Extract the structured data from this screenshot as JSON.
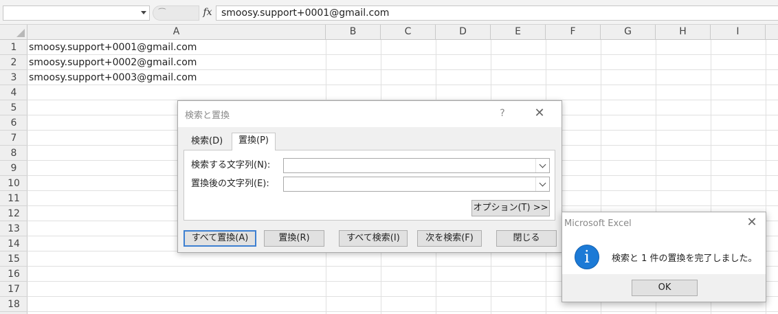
{
  "formula_bar": {
    "name_box_value": "",
    "fx_label": "fx",
    "dots": "⁀",
    "formula_value": "smoosy.support+0001@gmail.com"
  },
  "sheet": {
    "columns": [
      "A",
      "B",
      "C",
      "D",
      "E",
      "F",
      "G",
      "H",
      "I"
    ],
    "rows": [
      "1",
      "2",
      "3",
      "4",
      "5",
      "6",
      "7",
      "8",
      "9",
      "10",
      "11",
      "12",
      "13",
      "14",
      "15",
      "16",
      "17",
      "18"
    ],
    "cells": {
      "A1": "smoosy.support+0001@gmail.com",
      "A2": "smoosy.support+0002@gmail.com",
      "A3": "smoosy.support+0003@gmail.com"
    }
  },
  "find_replace_dialog": {
    "title": "検索と置換",
    "help_label": "?",
    "close_label": "✕",
    "tabs": [
      {
        "label": "検索(D)",
        "active": false
      },
      {
        "label": "置換(P)",
        "active": true
      }
    ],
    "find_label": "検索する文字列(N):",
    "find_value": "",
    "replace_label": "置換後の文字列(E):",
    "replace_value": "",
    "options_button": "オプション(T) >>",
    "buttons": {
      "replace_all": "すべて置換(A)",
      "replace": "置換(R)",
      "find_all": "すべて検索(I)",
      "find_next": "次を検索(F)",
      "close": "閉じる"
    }
  },
  "message_box": {
    "title": "Microsoft Excel",
    "close_label": "✕",
    "icon": "info-icon",
    "icon_glyph": "i",
    "message": "検索と 1 件の置換を完了しました。",
    "ok_button": "OK"
  }
}
